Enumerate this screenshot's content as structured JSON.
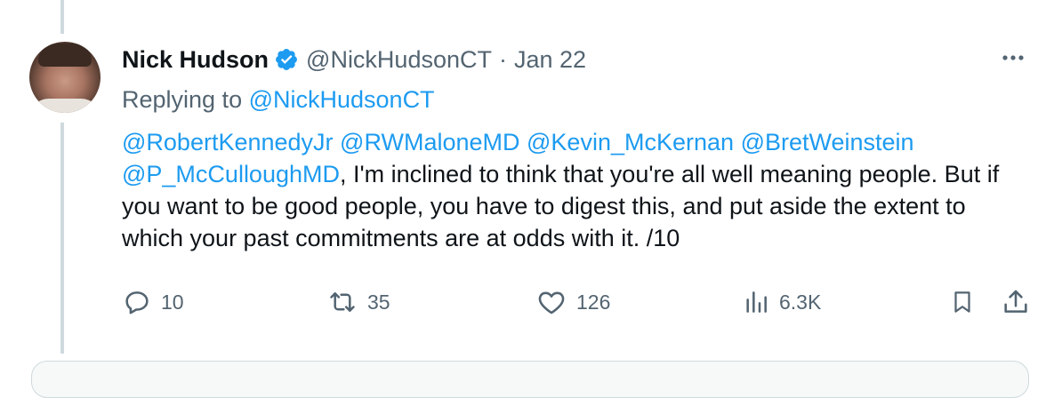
{
  "tweet": {
    "author_name": "Nick Hudson",
    "handle": "@NickHudsonCT",
    "separator": "·",
    "date": "Jan 22",
    "replying_prefix": "Replying to ",
    "replying_to": "@NickHudsonCT",
    "mentions": [
      "@RobertKennedyJr",
      "@RWMaloneMD",
      "@Kevin_McKernan",
      "@BretWeinstein",
      "@P_McCulloughMD"
    ],
    "body": ", I'm inclined to think that you're all well meaning people. But if you want to be good people, you have to digest this, and put aside the extent to which your past commitments are at odds with it. /10"
  },
  "actions": {
    "replies": "10",
    "reposts": "35",
    "likes": "126",
    "views": "6.3K"
  },
  "icons": {
    "verified": "verified-badge-icon",
    "more": "more-icon",
    "reply": "reply-icon",
    "repost": "repost-icon",
    "like": "heart-icon",
    "views": "views-chart-icon",
    "bookmark": "bookmark-icon",
    "share": "share-icon"
  },
  "colors": {
    "link": "#1d9bf0",
    "secondary_text": "#536471",
    "primary_text": "#0f1419",
    "thread_line": "#cfd9de"
  }
}
